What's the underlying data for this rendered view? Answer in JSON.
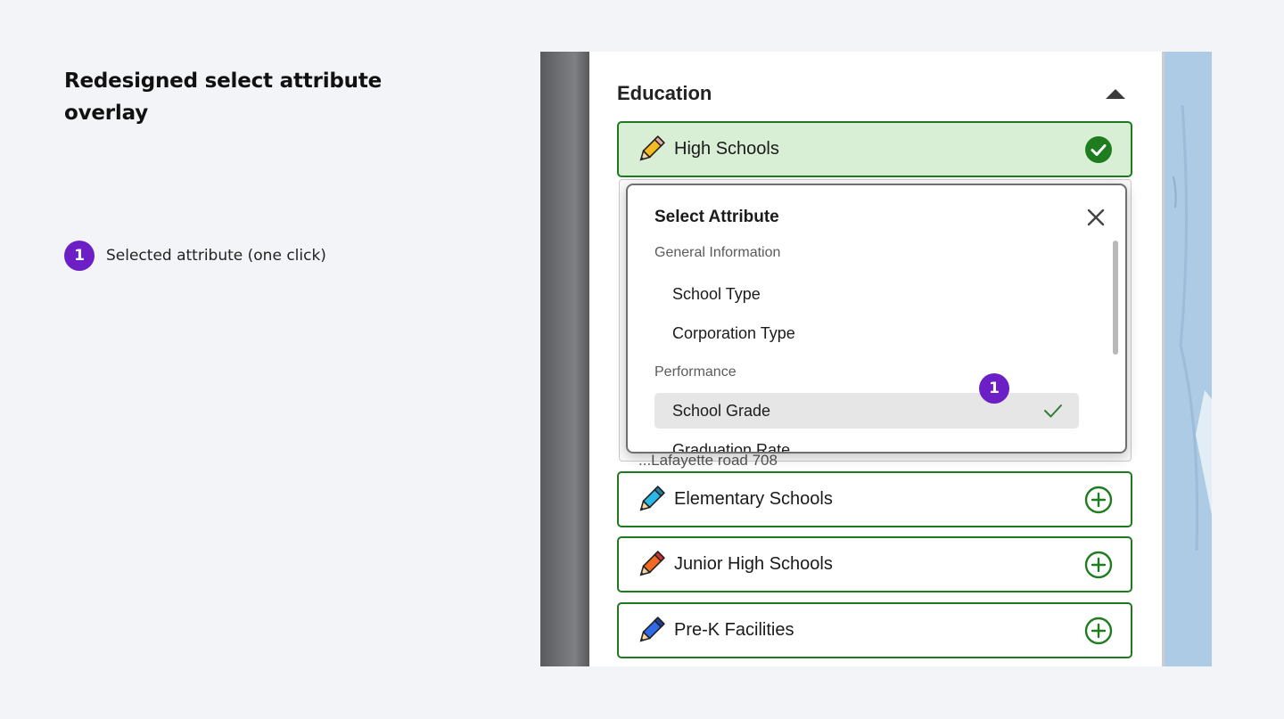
{
  "doc": {
    "title": "Redesigned select attribute overlay",
    "legend": [
      {
        "number": "1",
        "text": "Selected attribute (one click)"
      }
    ]
  },
  "panel": {
    "section_title": "Education",
    "layers": [
      {
        "label": "High Schools",
        "pencil_color": "#f5b921",
        "state": "selected"
      },
      {
        "label": "Elementary Schools",
        "pencil_color": "#2bb8e8",
        "state": "add"
      },
      {
        "label": "Junior High Schools",
        "pencil_color": "#f26a21",
        "state": "add"
      },
      {
        "label": "Pre-K Facilities",
        "pencil_color": "#2f6be8",
        "state": "add"
      }
    ],
    "behind_text": "...Lafayette road 708"
  },
  "overlay": {
    "title": "Select Attribute",
    "groups": [
      {
        "label": "General Information",
        "options": [
          "School Type",
          "Corporation Type"
        ]
      },
      {
        "label": "Performance",
        "options": [
          "School Grade",
          "Graduation Rate"
        ]
      }
    ],
    "selected_option": "School Grade",
    "marker": "1"
  },
  "colors": {
    "accent_green": "#1f7a1f",
    "selected_card_bg": "#d8efd6",
    "badge_purple": "#6c1fc4",
    "check_green": "#2f7d32"
  }
}
